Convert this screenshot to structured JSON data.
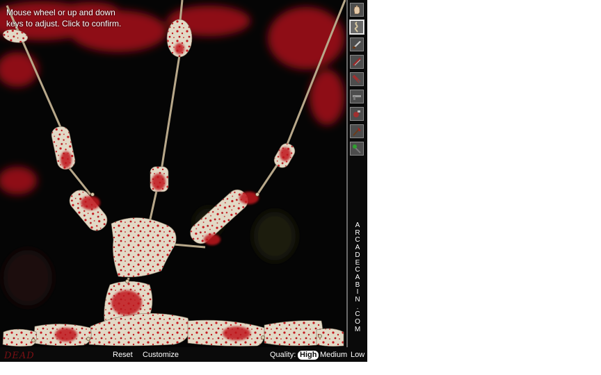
{
  "instructions": {
    "line1": "Mouse wheel or up and down",
    "line2": "keys to adjust. Click to confirm."
  },
  "bottom_bar": {
    "reset_label": "Reset",
    "customize_label": "Customize",
    "quality_label": "Quality:",
    "quality_options": [
      "High",
      "Medium",
      "Low"
    ],
    "quality_selected": "High"
  },
  "logo_text": "DEAD",
  "brand_letters": [
    "A",
    "R",
    "C",
    "A",
    "D",
    "E",
    "C",
    "A",
    "B",
    "I",
    "N",
    ".",
    "C",
    "O",
    "M"
  ],
  "tools": [
    {
      "name": "hand-tool",
      "icon": "hand-icon",
      "selected": false
    },
    {
      "name": "rope-tool",
      "icon": "rope-icon",
      "selected": true
    },
    {
      "name": "knife-tool",
      "icon": "knife-icon",
      "selected": false
    },
    {
      "name": "saw-tool",
      "icon": "saw-icon",
      "selected": false
    },
    {
      "name": "cleaver-tool",
      "icon": "cleaver-icon",
      "selected": false
    },
    {
      "name": "gun-tool",
      "icon": "gun-icon",
      "selected": false
    },
    {
      "name": "grenade-tool",
      "icon": "grenade-icon",
      "selected": false
    },
    {
      "name": "axe-tool",
      "icon": "axe-icon",
      "selected": false
    },
    {
      "name": "mace-tool",
      "icon": "mace-icon",
      "selected": false
    }
  ],
  "colors": {
    "blood": "#b0141a",
    "flesh": "#e4dccb",
    "rope": "#b8a88a",
    "background": "#050505",
    "ui_text": "#ffffff"
  }
}
